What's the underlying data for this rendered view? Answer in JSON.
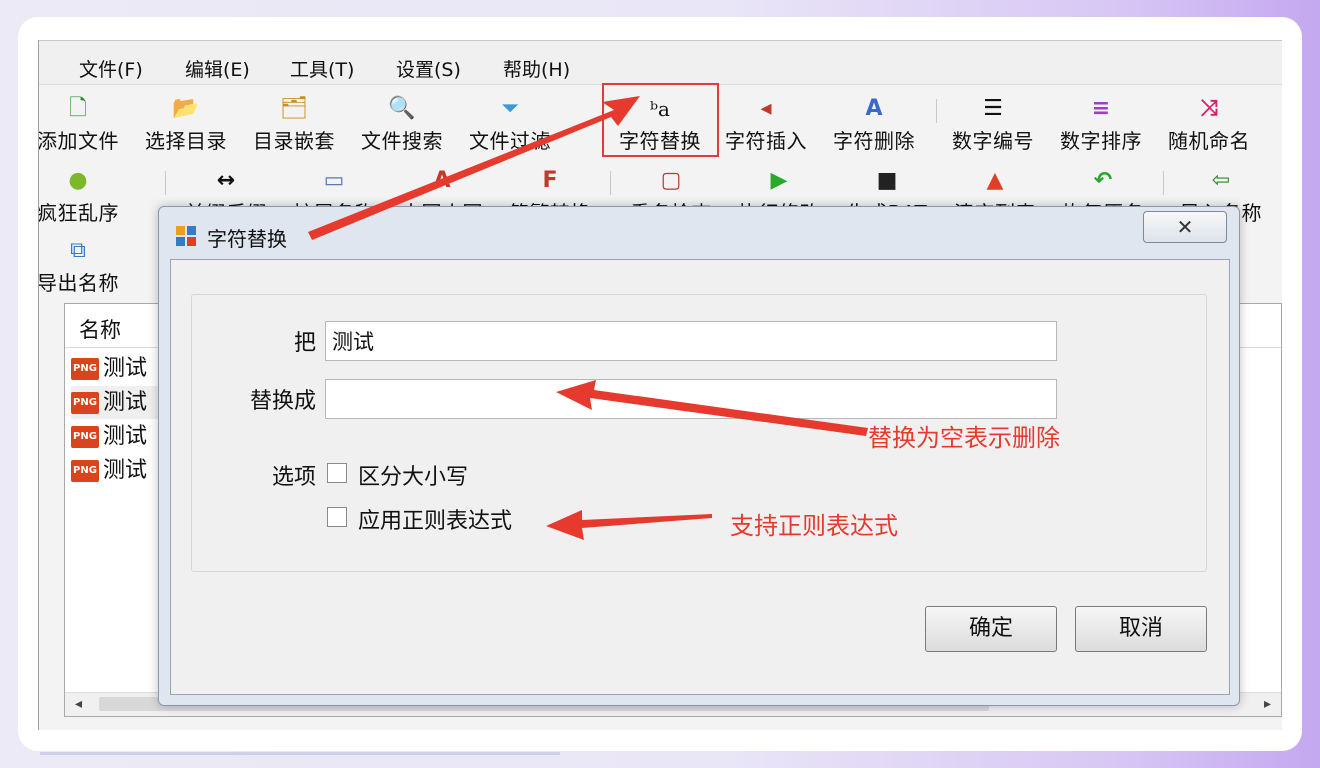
{
  "menu": [
    "文件(F)",
    "编辑(E)",
    "工具(T)",
    "设置(S)",
    "帮助(H)"
  ],
  "toolbar_row1": [
    {
      "label": "添加文件",
      "icon": "add-file-icon",
      "glyph": "🗋"
    },
    {
      "label": "选择目录",
      "icon": "folder-open-icon",
      "glyph": "📂"
    },
    {
      "label": "目录嵌套",
      "icon": "nested-folder-icon",
      "glyph": "🗂"
    },
    {
      "label": "文件搜索",
      "icon": "search-icon",
      "glyph": "🔍"
    },
    {
      "label": "文件过滤",
      "icon": "filter-icon",
      "glyph": "⏷"
    },
    {
      "label": "字符替换",
      "icon": "replace-icon",
      "glyph": "ᵇa"
    },
    {
      "label": "字符插入",
      "icon": "insert-icon",
      "glyph": "◂"
    },
    {
      "label": "字符删除",
      "icon": "delete-char-icon",
      "glyph": "A"
    },
    {
      "label": "数字编号",
      "icon": "numbered-list-icon",
      "glyph": "☰"
    },
    {
      "label": "数字排序",
      "icon": "sort-icon",
      "glyph": "≡"
    },
    {
      "label": "随机命名",
      "icon": "shuffle-icon",
      "glyph": "⤨"
    }
  ],
  "toolbar_row2": [
    {
      "label": "疯狂乱序",
      "icon": "android-icon",
      "glyph": "●"
    },
    {
      "label": "前缀后缀",
      "icon": "arrows-horizontal-icon",
      "glyph": "↔"
    },
    {
      "label": "扩展名称",
      "icon": "extension-icon",
      "glyph": "▭"
    },
    {
      "label": "大写小写",
      "icon": "case-icon",
      "glyph": "A"
    },
    {
      "label": "简繁转换",
      "icon": "simplified-traditional-icon",
      "glyph": "F"
    },
    {
      "label": "重名检查",
      "icon": "duplicate-check-icon",
      "glyph": "▢"
    },
    {
      "label": "执行修改",
      "icon": "play-icon",
      "glyph": "▶"
    },
    {
      "label": "生成BAT",
      "icon": "terminal-icon",
      "glyph": "■"
    },
    {
      "label": "清空列表",
      "icon": "eraser-icon",
      "glyph": "▲"
    },
    {
      "label": "恢复原名",
      "icon": "undo-icon",
      "glyph": "↶"
    },
    {
      "label": "导入名称",
      "icon": "import-icon",
      "glyph": "⇦"
    }
  ],
  "toolbar_row3": [
    {
      "label": "导出名称",
      "icon": "export-icon",
      "glyph": "⧉"
    }
  ],
  "list": {
    "column_name": "名称",
    "rows": [
      "测试",
      "测试",
      "测试",
      "测试"
    ],
    "file_badge": "PNG"
  },
  "dialog": {
    "title": "字符替换",
    "close_glyph": "✕",
    "find_label": "把",
    "find_value": "测试",
    "replace_label": "替换成",
    "replace_value": "",
    "options_label": "选项",
    "case_sensitive_label": "区分大小写",
    "case_sensitive_checked": false,
    "regex_label": "应用正则表达式",
    "regex_checked": false,
    "ok_label": "确定",
    "cancel_label": "取消"
  },
  "annotations": {
    "empty_replace_note": "替换为空表示删除",
    "regex_note": "支持正则表达式",
    "color": "#e63a2f"
  }
}
